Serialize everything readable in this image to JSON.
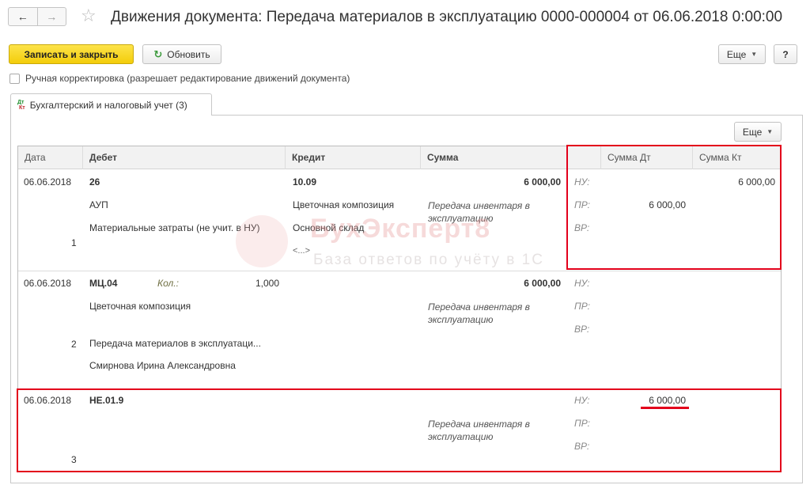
{
  "window": {
    "title": "Движения документа: Передача материалов в эксплуатацию 0000-000004 от 06.06.2018 0:00:00"
  },
  "nav": {
    "back": "←",
    "forward": "→",
    "favorite": "☆"
  },
  "toolbar": {
    "save_close": "Записать и закрыть",
    "refresh": "Обновить",
    "refresh_icon": "↻",
    "more": "Еще",
    "help": "?"
  },
  "manual": {
    "label": "Ручная корректировка (разрешает редактирование движений документа)",
    "checked": false
  },
  "tab": {
    "icon_dt": "Дт",
    "icon_kt": "Кт",
    "label": "Бухгалтерский и налоговый учет (3)"
  },
  "grid_toolbar": {
    "more": "Еще"
  },
  "grid": {
    "headers": [
      "Дата",
      "Дебет",
      "Кредит",
      "Сумма",
      "",
      "Сумма Дт",
      "Сумма Кт"
    ],
    "rows": [
      {
        "date": "06.06.2018",
        "num": "1",
        "debit_account": "26",
        "debit_sub1": "АУП",
        "debit_sub2": "Материальные затраты (не учит. в НУ)",
        "credit_account": "10.09",
        "credit_sub1": "Цветочная композиция",
        "credit_sub2": "Основной склад",
        "credit_sub3": "<...>",
        "sum": "6 000,00",
        "content": "Передача инвентаря в эксплуатацию",
        "nu": "НУ:",
        "pr": "ПР:",
        "vr": "ВР:",
        "kt_nu": "6 000,00",
        "dt_pr": "6 000,00"
      },
      {
        "date": "06.06.2018",
        "num": "2",
        "debit_account": "МЦ.04",
        "kol_label": "Кол.:",
        "kol_value": "1,000",
        "debit_sub1": "Цветочная композиция",
        "debit_sub2": "Передача материалов в эксплуатаци...",
        "debit_sub3": "Смирнова Ирина Александровна",
        "sum": "6 000,00",
        "content": "Передача инвентаря в эксплуатацию",
        "nu": "НУ:",
        "pr": "ПР:",
        "vr": "ВР:"
      },
      {
        "date": "06.06.2018",
        "num": "3",
        "debit_account": "НЕ.01.9",
        "content": "Передача инвентаря в эксплуатацию",
        "nu": "НУ:",
        "pr": "ПР:",
        "vr": "ВР:",
        "dt_nu": "6 000,00"
      }
    ]
  },
  "watermark": {
    "main": "БухЭксперт8",
    "sub": "База ответов по учёту в 1С"
  },
  "colors": {
    "primary_button": "#f5d21a",
    "highlight": "#e3001b",
    "refresh_icon": "#3c9a3c"
  }
}
